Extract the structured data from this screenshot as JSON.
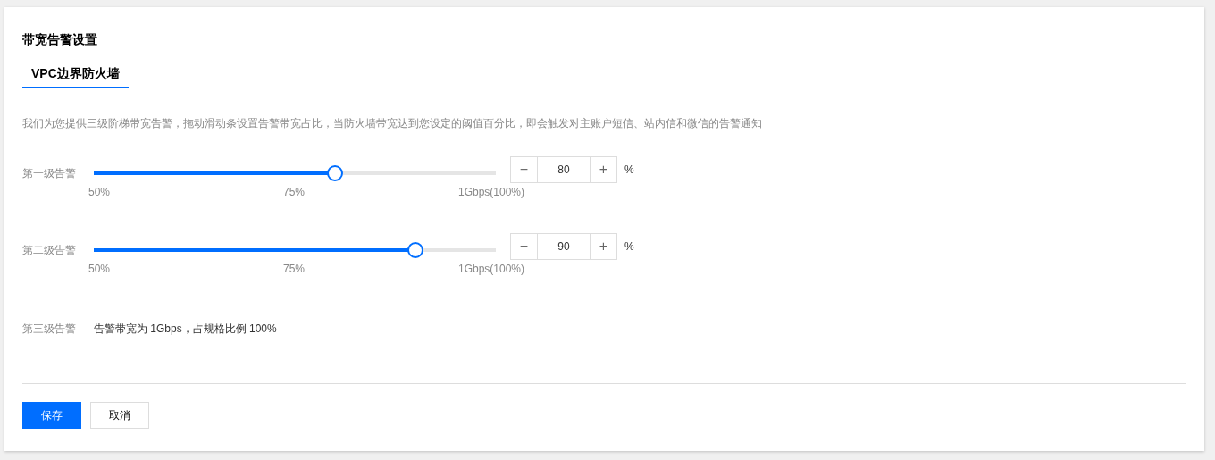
{
  "title": "带宽告警设置",
  "tabs": [
    {
      "label": "VPC边界防火墙",
      "selected": true
    }
  ],
  "description": "我们为您提供三级阶梯带宽告警，拖动滑动条设置告警带宽占比，当防火墙带宽达到您设定的阈值百分比，即会触发对主账户短信、站内信和微信的告警通知",
  "levels": [
    {
      "kind": "slider",
      "label": "第一级告警",
      "level": 0.6,
      "ticks": [
        "50%",
        "75%",
        "1Gbps(100%)"
      ],
      "stepper": {
        "minus": "−",
        "value": "80",
        "plus": "+",
        "unit": "%"
      }
    },
    {
      "kind": "slider",
      "label": "第二级告警",
      "level": 0.8,
      "ticks": [
        "50%",
        "75%",
        "1Gbps(100%)"
      ],
      "stepper": {
        "minus": "−",
        "value": "90",
        "plus": "+",
        "unit": "%"
      }
    },
    {
      "kind": "text",
      "label": "第三级告警",
      "text": "告警带宽为 1Gbps，占规格比例 100%"
    }
  ],
  "buttons": [
    {
      "label": "保存",
      "kind": "primary"
    },
    {
      "label": "取消",
      "kind": "default"
    }
  ]
}
